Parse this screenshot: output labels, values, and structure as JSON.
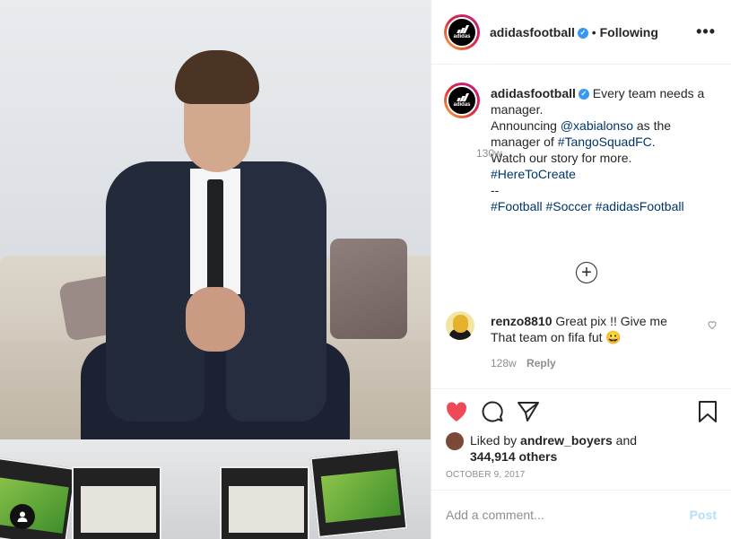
{
  "post": {
    "username": "adidasfootball",
    "follow_state": "Following",
    "separator": "•",
    "more_label": "•••",
    "avatar_text": "adidas",
    "caption": {
      "username": "adidasfootball",
      "lines": [
        "Every team needs a",
        "manager.",
        "Announcing ",
        "@xabialonso",
        " as the",
        "manager of ",
        "#TangoSquadFC",
        ".",
        "Watch our story for more.",
        "#HereToCreate",
        "--",
        "#Football",
        "#Soccer",
        "#adidasFootball"
      ],
      "time": "130w"
    },
    "load_more_icon": "+",
    "comment": {
      "username": "renzo8810",
      "text_line1": "Great pix !! Give me",
      "text_line2": "That team on fifa fut 😀",
      "time": "128w",
      "reply": "Reply",
      "heart_icon": "heart-outline-icon"
    },
    "likes": {
      "prefix": "Liked by ",
      "first_user": "andrew_boyers",
      "and_text": " and",
      "others": "344,914 others"
    },
    "date": "OCTOBER 9, 2017",
    "add_comment": {
      "placeholder": "Add a comment...",
      "post_label": "Post"
    },
    "colors": {
      "like_red": "#ed4956",
      "link_blue": "#003569",
      "verified_blue": "#3897f0",
      "post_disabled": "#b2dffc"
    }
  }
}
